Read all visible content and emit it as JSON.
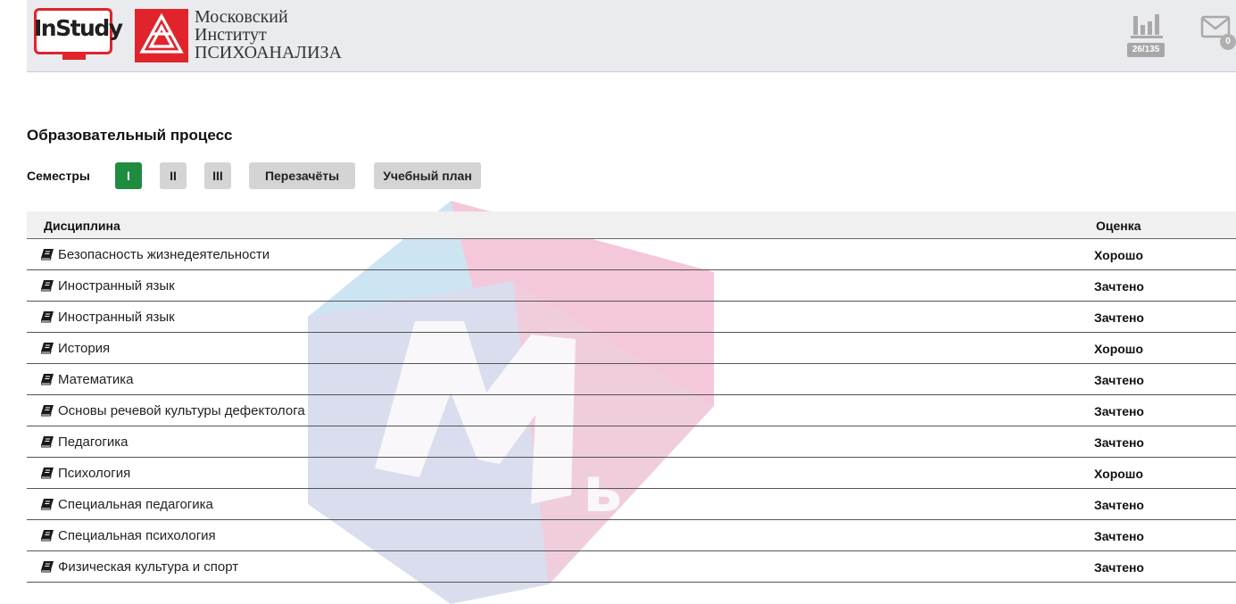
{
  "header": {
    "instudy_logo_text": "InStudy",
    "institute_name": [
      "Московский",
      "Институт",
      "ПСИХОАНАЛИЗА"
    ],
    "stats_badge": "26/135",
    "mail_count": "0"
  },
  "page": {
    "title": "Образовательный процесс",
    "semesters_label": "Семестры",
    "buttons": [
      {
        "label": "I",
        "active": true
      },
      {
        "label": "II",
        "active": false
      },
      {
        "label": "III",
        "active": false
      },
      {
        "label": "Перезачёты",
        "active": false
      },
      {
        "label": "Учебный план",
        "active": false
      }
    ]
  },
  "table": {
    "headers": {
      "discipline": "Дисциплина",
      "grade": "Оценка"
    },
    "rows": [
      {
        "discipline": "Безопасность жизнедеятельности",
        "grade": "Хорошо"
      },
      {
        "discipline": "Иностранный язык",
        "grade": "Зачтено"
      },
      {
        "discipline": "Иностранный язык",
        "grade": "Зачтено"
      },
      {
        "discipline": "История",
        "grade": "Хорошо"
      },
      {
        "discipline": "Математика",
        "grade": "Зачтено"
      },
      {
        "discipline": "Основы речевой культуры дефектолога",
        "grade": "Зачтено"
      },
      {
        "discipline": "Педагогика",
        "grade": "Зачтено"
      },
      {
        "discipline": "Психология",
        "grade": "Хорошо"
      },
      {
        "discipline": "Специальная педагогика",
        "grade": "Зачтено"
      },
      {
        "discipline": "Специальная психология",
        "grade": "Зачтено"
      },
      {
        "discipline": "Физическая культура и спорт",
        "grade": "Зачтено"
      }
    ]
  },
  "icons": {
    "row_icon": "book-icon",
    "stats": "bar-chart-icon",
    "mail": "envelope-icon"
  },
  "colors": {
    "active_button": "#1f8c3f",
    "brand_red": "#e1242b",
    "header_bg": "#eaebef"
  }
}
